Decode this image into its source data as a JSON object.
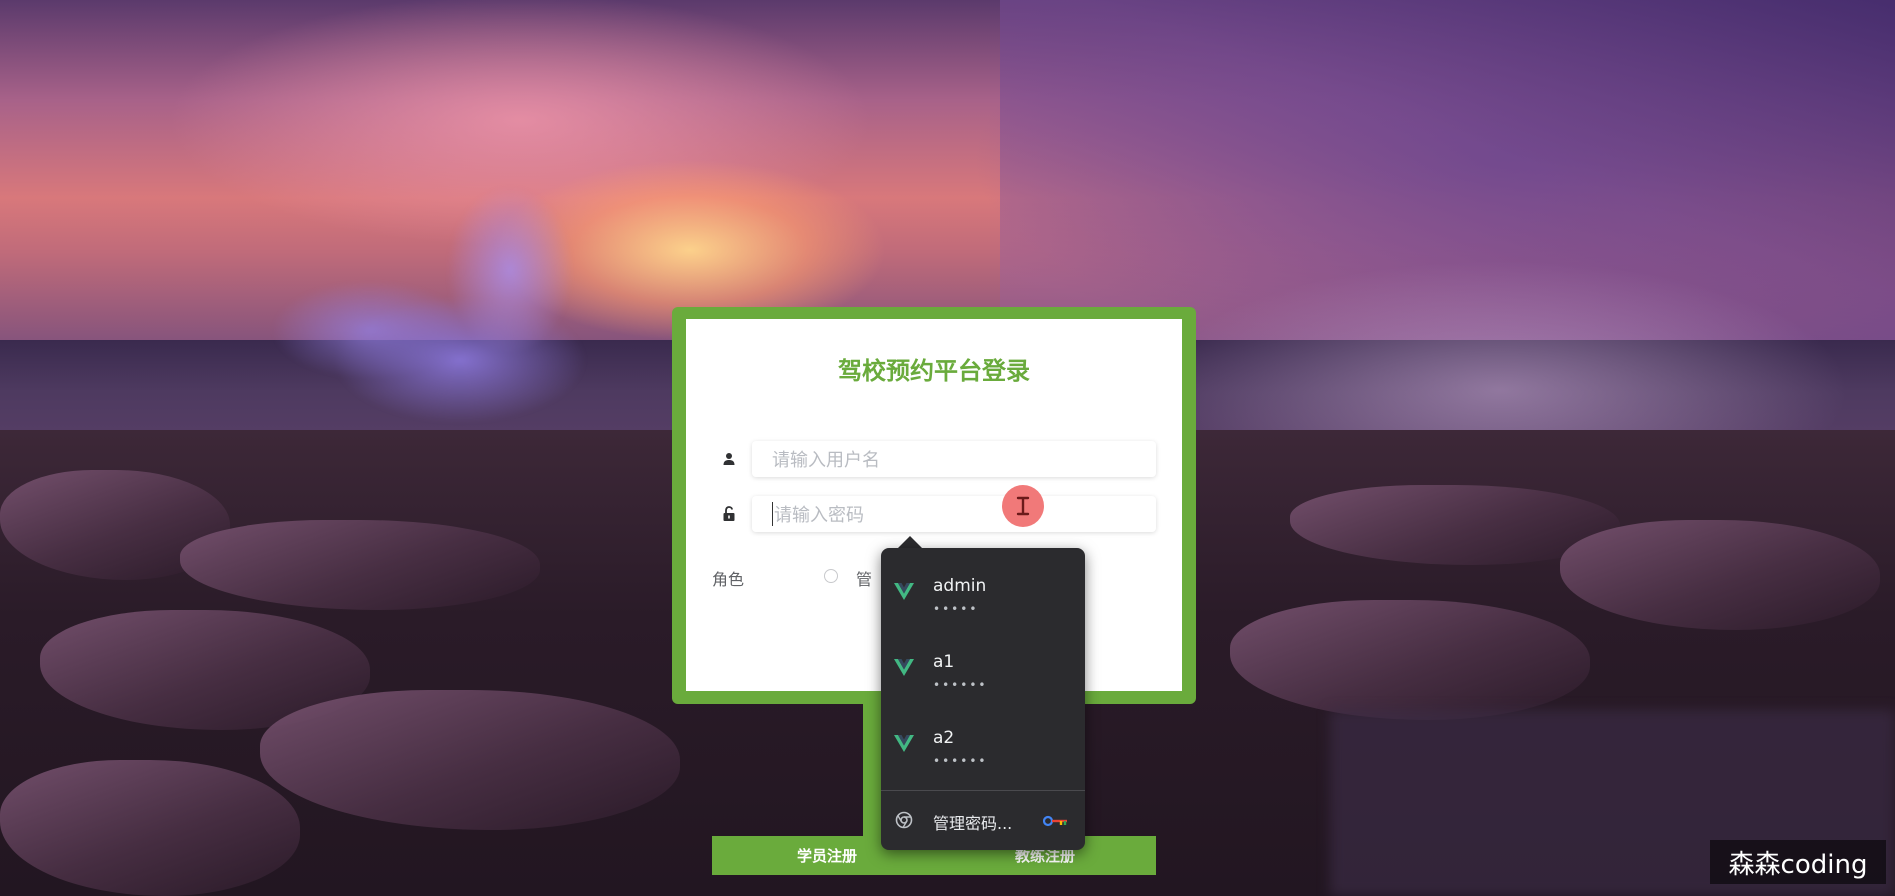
{
  "login": {
    "title": "驾校预约平台登录",
    "username_placeholder": "请输入用户名",
    "password_placeholder": "请输入密码",
    "role_label": "角色",
    "role_option_visible": "管"
  },
  "register": {
    "student_label": "学员注册",
    "coach_label": "教练注册"
  },
  "password_dropdown": {
    "entries": [
      {
        "username": "admin",
        "masked": "•••••"
      },
      {
        "username": "a1",
        "masked": "••••••"
      },
      {
        "username": "a2",
        "masked": "••••••"
      }
    ],
    "manage_label": "管理密码..."
  },
  "watermark": "森森coding",
  "colors": {
    "accent": "#6aab3c",
    "popup_bg": "#2b2b2e",
    "vue_green": "#42b883"
  },
  "icons": [
    "user-icon",
    "lock-icon",
    "vue-logo-icon",
    "chrome-icon",
    "key-icon",
    "text-cursor-icon"
  ]
}
